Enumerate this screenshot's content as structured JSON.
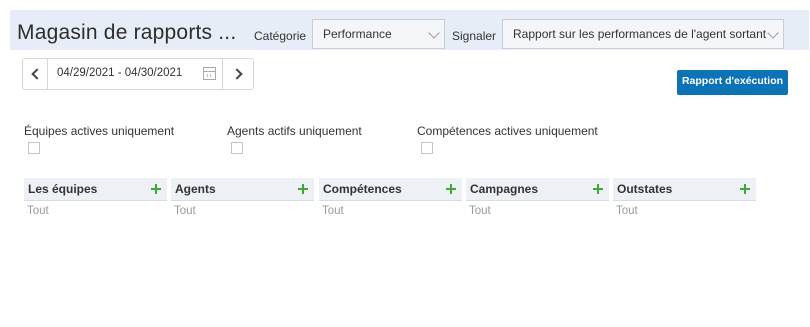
{
  "header": {
    "title": "Magasin de rapports ...",
    "category_label": "Catégorie",
    "category_value": "Performance",
    "report_label": "Signaler",
    "report_value": "Rapport sur les performances de l'agent sortant"
  },
  "toolbar": {
    "date_range": "04/29/2021 - 04/30/2021",
    "run_button": "Rapport d'exécution"
  },
  "filters": [
    {
      "label": "Équipes actives uniquement",
      "checked": false
    },
    {
      "label": "Agents actifs uniquement",
      "checked": false
    },
    {
      "label": "Compétences actives uniquement",
      "checked": false
    }
  ],
  "columns": [
    {
      "name": "Les équipes",
      "value": "Tout"
    },
    {
      "name": "Agents",
      "value": "Tout"
    },
    {
      "name": "Compétences",
      "value": "Tout"
    },
    {
      "name": "Campagnes",
      "value": "Tout"
    },
    {
      "name": "Outstates",
      "value": "Tout"
    }
  ],
  "icons": {
    "prev": "chevron-left-icon",
    "next": "chevron-right-icon",
    "calendar": "calendar-icon",
    "add": "plus-icon",
    "dropdown": "chevron-down-icon"
  },
  "colors": {
    "header_bg": "#e7edf6",
    "run_button_bg": "#0d73b7",
    "plus_green": "#3aa935"
  }
}
